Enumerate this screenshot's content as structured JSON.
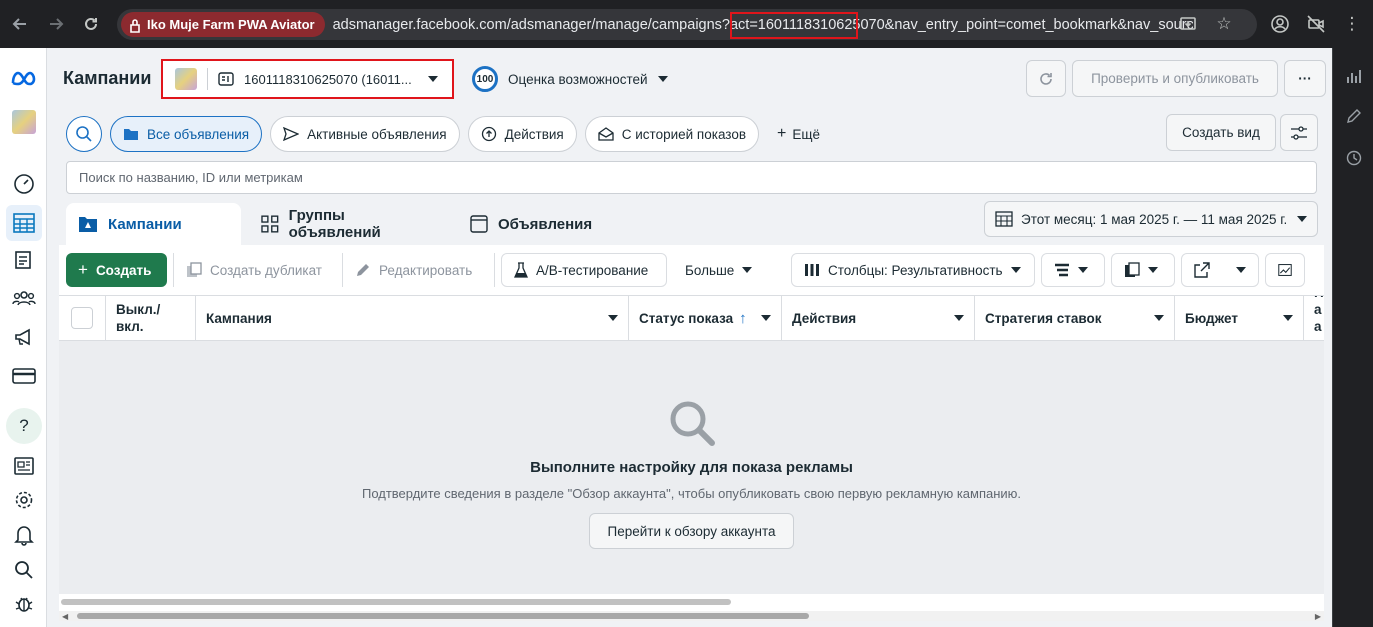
{
  "browser": {
    "profile_label": "Iko Muje Farm PWA Aviator",
    "url": "adsmanager.facebook.com/adsmanager/manage/campaigns?act=1601118310625070&nav_entry_point=comet_bookmark&nav_source=..."
  },
  "header": {
    "title": "Кампании",
    "account_label": "1601118310625070 (16011...",
    "score_value": "100",
    "score_label": "Оценка возможностей",
    "review_publish": "Проверить и опубликовать"
  },
  "filters": {
    "items": [
      "Все объявления",
      "Активные объявления",
      "Действия",
      "С историей показов"
    ],
    "more": "Ещё",
    "create_view": "Создать вид"
  },
  "search": {
    "placeholder": "Поиск по названию, ID или метрикам"
  },
  "tabs": [
    "Кампании",
    "Группы объявлений",
    "Объявления"
  ],
  "date_range": "Этот месяц: 1 мая 2025 г. — 11 мая 2025 г.",
  "toolbar": {
    "create": "Создать",
    "duplicate": "Создать дубликат",
    "edit": "Редактировать",
    "ab_test": "A/B-тестирование",
    "more": "Больше",
    "columns": "Столбцы: Результативность"
  },
  "table": {
    "columns": [
      "Выкл./вкл.",
      "Кампания",
      "Статус показа",
      "Действия",
      "Стратегия ставок",
      "Бюджет",
      "На ат"
    ]
  },
  "empty_state": {
    "title": "Выполните настройку для показа рекламы",
    "subtitle": "Подтвердите сведения в разделе \"Обзор аккаунта\", чтобы опубликовать свою первую рекламную кампанию.",
    "button": "Перейти к обзору аккаунта"
  },
  "colors": {
    "accent": "#1d72c4",
    "create_green": "#1f7a4d",
    "highlight_red": "#e0151b"
  }
}
